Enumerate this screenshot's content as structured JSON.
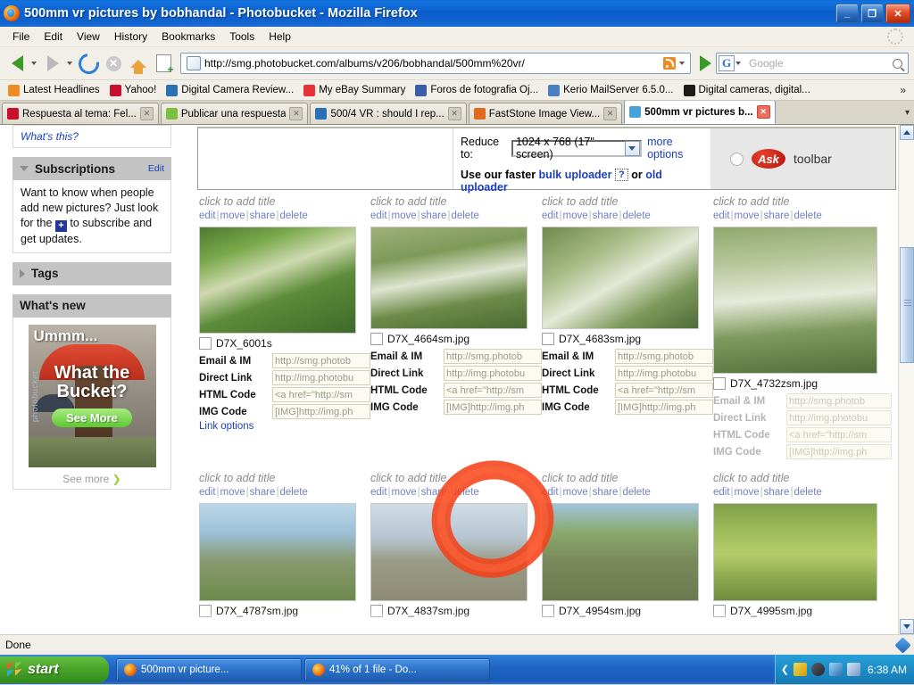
{
  "window": {
    "title": "500mm vr pictures by bobhandal - Photobucket - Mozilla Firefox",
    "minimize": "_",
    "restore": "❐",
    "close": "✕"
  },
  "menu": [
    "File",
    "Edit",
    "View",
    "History",
    "Bookmarks",
    "Tools",
    "Help"
  ],
  "nav": {
    "url": "http://smg.photobucket.com/albums/v206/bobhandal/500mm%20vr/",
    "search_engine": "G",
    "search_placeholder": "Google"
  },
  "bookmarks": [
    {
      "label": "Latest Headlines",
      "icon": "rss-icon",
      "color": "#f08a24"
    },
    {
      "label": "Yahoo!",
      "icon": "yahoo-icon",
      "color": "#c8102e"
    },
    {
      "label": "Digital Camera Review...",
      "icon": "globe-icon",
      "color": "#2b6fb5"
    },
    {
      "label": "My eBay Summary",
      "icon": "ebay-icon",
      "color": "#e53238"
    },
    {
      "label": "Foros de fotografia Oj...",
      "icon": "molecule-icon",
      "color": "#3b5ea8"
    },
    {
      "label": "Kerio MailServer 6.5.0...",
      "icon": "mail-icon",
      "color": "#4a7fc1"
    },
    {
      "label": "Digital cameras, digital...",
      "icon": "dpreview-icon",
      "color": "#1a1a1a"
    }
  ],
  "bookmarks_overflow": "»",
  "tabs": [
    {
      "label": "Respuesta al tema: Fel...",
      "icon": "yahoo-icon",
      "color": "#c8102e",
      "active": false
    },
    {
      "label": "Publicar una respuesta",
      "icon": "speech-icon",
      "color": "#7bbf3f",
      "active": false
    },
    {
      "label": "500/4 VR : should I rep...",
      "icon": "globe-icon",
      "color": "#2b6fb5",
      "active": false
    },
    {
      "label": "FastStone Image View...",
      "icon": "faststone-icon",
      "color": "#e06a1c",
      "active": false
    },
    {
      "label": "500mm vr pictures b...",
      "icon": "photobucket-icon",
      "color": "#4aa3d8",
      "active": true
    }
  ],
  "tabs_dropdown": "▾",
  "sidebar": {
    "whats_this": "What's this?",
    "subscriptions": {
      "title": "Subscriptions",
      "edit": "Edit",
      "body_before": "Want to know when people add new pictures? Just look for the",
      "badge": "+",
      "body_after": "to subscribe and get updates."
    },
    "tags": {
      "title": "Tags"
    },
    "whats_new": {
      "title": "What's new",
      "promo_caption": "Ummm...",
      "promo_line1": "What the",
      "promo_line2": "Bucket?",
      "promo_button": "See More",
      "watermark": "photobucket",
      "see_more": "See more",
      "see_more_chevron": "❯"
    }
  },
  "toolbar": {
    "reduce_label": "Reduce to:",
    "reduce_value": "1024 x 768 (17\" screen)",
    "more_options": "more options",
    "uploader_prefix": "Use our faster",
    "bulk_uploader": "bulk uploader",
    "help_mark": "?",
    "uploader_or": "or",
    "old_uploader": "old uploader",
    "ask_brand": "Ask",
    "ask_label": "toolbar"
  },
  "photo_common": {
    "title_placeholder": "click to add title",
    "actions": [
      "edit",
      "move",
      "share",
      "delete"
    ],
    "action_sep": "|",
    "field_labels": [
      "Email & IM",
      "Direct Link",
      "HTML Code",
      "IMG Code"
    ],
    "field_values": [
      "http://smg.photob",
      "http://img.photobu",
      "<a href=\"http://sm",
      "[IMG]http://img.ph"
    ],
    "link_options": "Link options"
  },
  "photos_row1": [
    {
      "filename": "D7X_6001s",
      "subject": "white-faced capuchin monkey in green foliage",
      "tall": false,
      "dim": false
    },
    {
      "filename": "D7X_4664sm.jpg",
      "subject": "bald eagle perched on branch",
      "tall": false,
      "dim": false
    },
    {
      "filename": "D7X_4683sm.jpg",
      "subject": "bald eagle on tree limb",
      "tall": false,
      "dim": false
    },
    {
      "filename": "D7X_4732zsm.jpg",
      "subject": "osprey perched in tree, vertical crop",
      "tall": true,
      "dim": true
    }
  ],
  "photos_row2": [
    {
      "filename": "D7X_4787sm.jpg",
      "subject": "osprey nest in dead tree"
    },
    {
      "filename": "D7X_4837sm.jpg",
      "subject": "two ospreys in large stick nest"
    },
    {
      "filename": "D7X_4954sm.jpg",
      "subject": "osprey nest against rock face"
    },
    {
      "filename": "D7X_4995sm.jpg",
      "subject": "alligator in green pond water"
    }
  ],
  "status": {
    "text": "Done",
    "shield_icon": "security-shield-icon"
  },
  "taskbar": {
    "start": "start",
    "items": [
      {
        "label": "500mm vr picture...",
        "icon": "firefox-icon"
      },
      {
        "label": "41% of 1 file - Do...",
        "icon": "firefox-icon"
      }
    ],
    "tray_chevron": "❮",
    "tray_icons": [
      "antivirus-icon",
      "media-icon",
      "network-icon",
      "user-icon"
    ],
    "clock": "6:38 AM"
  }
}
